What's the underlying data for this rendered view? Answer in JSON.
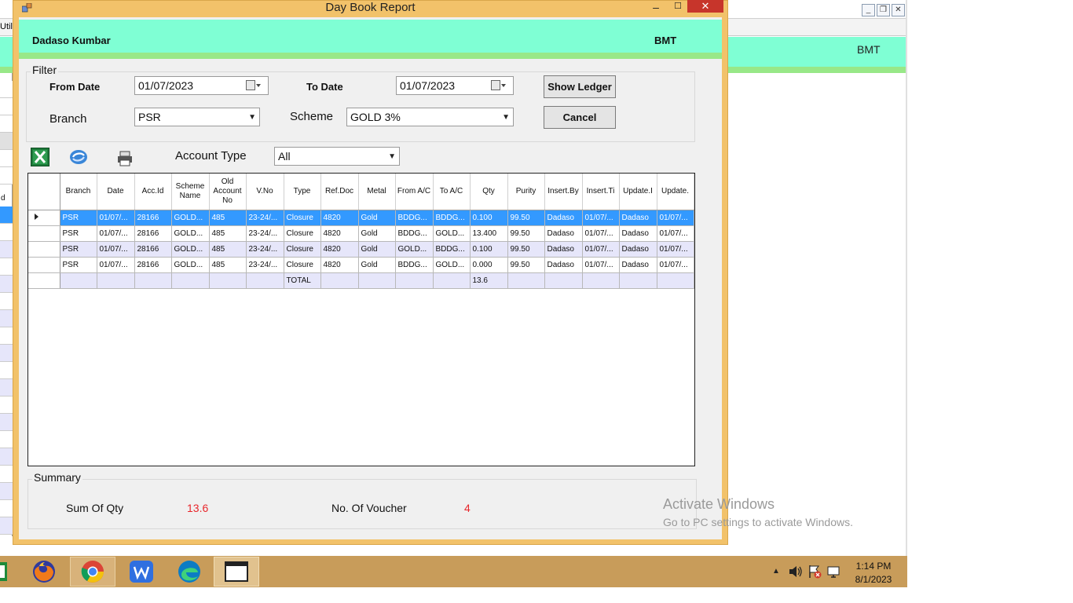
{
  "background_app": {
    "menu_fragment": "Utili",
    "header_text": "BMT",
    "left_label": "d"
  },
  "dialog": {
    "title": "Day Book Report",
    "minimize": "‒",
    "maximize": "☐",
    "close": "✕",
    "header": {
      "user": "Dadaso Kumbar",
      "code": "BMT"
    }
  },
  "filter": {
    "legend": "Filter",
    "from_date_label": "From Date",
    "from_date": "01/07/2023",
    "to_date_label": "To Date",
    "to_date": "01/07/2023",
    "show_ledger": "Show Ledger",
    "branch_label": "Branch",
    "branch": "PSR",
    "scheme_label": "Scheme",
    "scheme": "GOLD 3%",
    "cancel": "Cancel"
  },
  "toolbar": {
    "account_type_label": "Account Type",
    "account_type": "All",
    "icons": [
      "excel-export-icon",
      "refresh-icon",
      "print-icon"
    ]
  },
  "grid": {
    "columns": [
      "Branch",
      "Date",
      "Acc.Id",
      "Scheme Name",
      "Old Account No",
      "V.No",
      "Type",
      "Ref.Doc",
      "Metal",
      "From A/C",
      "To A/C",
      "Qty",
      "Purity",
      "Insert.By",
      "Insert.Ti",
      "Update.I",
      "Update."
    ],
    "rows": [
      [
        "PSR",
        "01/07/...",
        "28166",
        "GOLD...",
        "485",
        "23-24/...",
        "Closure",
        "4820",
        "Gold",
        "BDDG...",
        "BDDG...",
        "0.100",
        "99.50",
        "Dadaso",
        "01/07/...",
        "Dadaso",
        "01/07/..."
      ],
      [
        "PSR",
        "01/07/...",
        "28166",
        "GOLD...",
        "485",
        "23-24/...",
        "Closure",
        "4820",
        "Gold",
        "BDDG...",
        "GOLD...",
        "13.400",
        "99.50",
        "Dadaso",
        "01/07/...",
        "Dadaso",
        "01/07/..."
      ],
      [
        "PSR",
        "01/07/...",
        "28166",
        "GOLD...",
        "485",
        "23-24/...",
        "Closure",
        "4820",
        "Gold",
        "GOLD...",
        "BDDG...",
        "0.100",
        "99.50",
        "Dadaso",
        "01/07/...",
        "Dadaso",
        "01/07/..."
      ],
      [
        "PSR",
        "01/07/...",
        "28166",
        "GOLD...",
        "485",
        "23-24/...",
        "Closure",
        "4820",
        "Gold",
        "BDDG...",
        "GOLD...",
        "0.000",
        "99.50",
        "Dadaso",
        "01/07/...",
        "Dadaso",
        "01/07/..."
      ]
    ],
    "total_label": "TOTAL",
    "total_qty": "13.6"
  },
  "summary": {
    "legend": "Summary",
    "sum_qty_label": "Sum Of Qty",
    "sum_qty": "13.6",
    "voucher_label": "No. Of Voucher",
    "voucher_count": "4"
  },
  "watermark": {
    "line1": "Activate Windows",
    "line2": "Go to PC settings to activate Windows."
  },
  "taskbar": {
    "apps": [
      "spreadsheet-icon",
      "firefox-icon",
      "chrome-icon",
      "wps-writer-icon",
      "edge-icon",
      "window-app-icon"
    ],
    "time": "1:14 PM",
    "date": "8/1/2023"
  },
  "colors": {
    "header_band": "#7fffd4",
    "header_green": "#98e888",
    "dialog_frame": "#f2c26a",
    "selection": "#3399ff",
    "alt_row": "#e6e6fa",
    "summary_value": "#e8262b",
    "taskbar": "#c89c5a"
  }
}
